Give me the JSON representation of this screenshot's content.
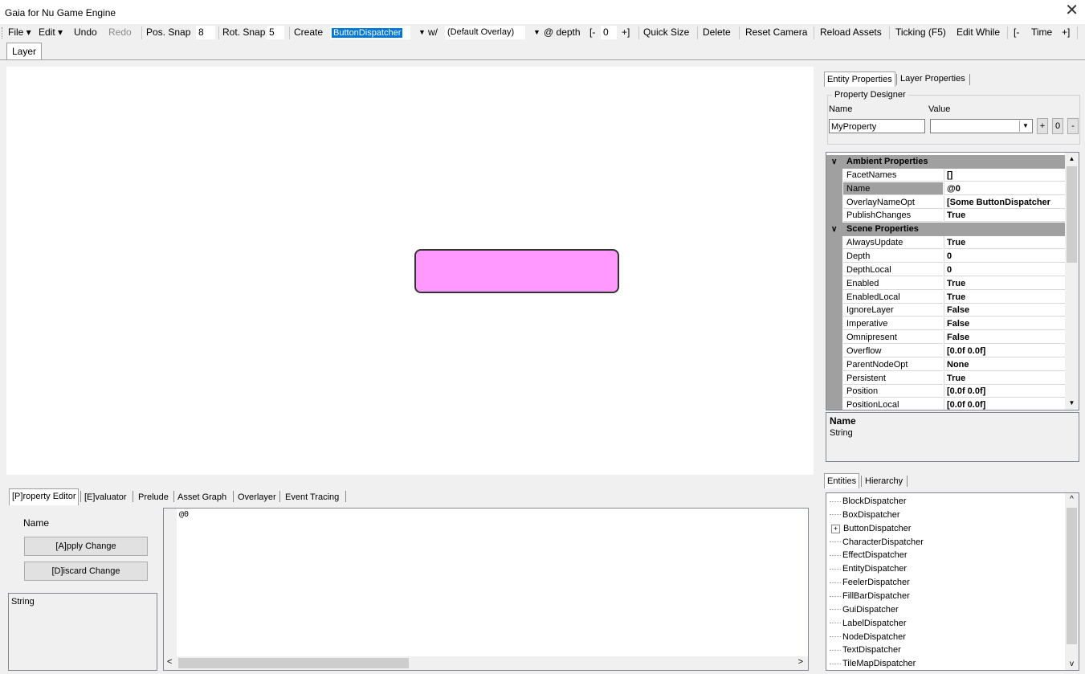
{
  "window": {
    "title": "Gaia for Nu Game Engine"
  },
  "toolbar": {
    "file": "File",
    "edit": "Edit",
    "undo": "Undo",
    "redo": "Redo",
    "pos_snap_label": "Pos. Snap",
    "pos_snap_value": "8",
    "rot_snap_label": "Rot. Snap",
    "rot_snap_value": "5",
    "create": "Create",
    "dispatcher_selected": "ButtonDispatcher",
    "with": "w/",
    "overlay_selected": "(Default Overlay)",
    "at_depth": "@ depth",
    "depth_minus": "[-",
    "depth_value": "0",
    "depth_plus": "+]",
    "quick_size": "Quick Size",
    "delete": "Delete",
    "reset_camera": "Reset Camera",
    "reload_assets": "Reload Assets",
    "ticking": "Ticking (F5)",
    "edit_while": "Edit While",
    "time_minus": "[-",
    "time_label": "Time",
    "time_plus": "+]"
  },
  "layer_tab": "Layer",
  "property_tabs": {
    "entity": "Entity Properties",
    "layer": "Layer Properties"
  },
  "property_designer": {
    "group_label": "Property Designer",
    "name_header": "Name",
    "value_header": "Value",
    "name_value": "MyProperty",
    "value_value": "",
    "plus": "+",
    "zero": "0",
    "minus": "-"
  },
  "property_grid": [
    {
      "type": "category",
      "label": "Ambient Properties"
    },
    {
      "type": "prop",
      "name": "FacetNames",
      "value": "[]"
    },
    {
      "type": "prop",
      "name": "Name",
      "value": "@0",
      "selected": true
    },
    {
      "type": "prop",
      "name": "OverlayNameOpt",
      "value": "[Some ButtonDispatcher"
    },
    {
      "type": "prop",
      "name": "PublishChanges",
      "value": "True"
    },
    {
      "type": "category",
      "label": "Scene Properties"
    },
    {
      "type": "prop",
      "name": "AlwaysUpdate",
      "value": "True"
    },
    {
      "type": "prop",
      "name": "Depth",
      "value": "0"
    },
    {
      "type": "prop",
      "name": "DepthLocal",
      "value": "0"
    },
    {
      "type": "prop",
      "name": "Enabled",
      "value": "True"
    },
    {
      "type": "prop",
      "name": "EnabledLocal",
      "value": "True"
    },
    {
      "type": "prop",
      "name": "IgnoreLayer",
      "value": "False"
    },
    {
      "type": "prop",
      "name": "Imperative",
      "value": "False"
    },
    {
      "type": "prop",
      "name": "Omnipresent",
      "value": "False"
    },
    {
      "type": "prop",
      "name": "Overflow",
      "value": "[0.0f 0.0f]"
    },
    {
      "type": "prop",
      "name": "ParentNodeOpt",
      "value": "None"
    },
    {
      "type": "prop",
      "name": "Persistent",
      "value": "True"
    },
    {
      "type": "prop",
      "name": "Position",
      "value": "[0.0f 0.0f]"
    },
    {
      "type": "prop",
      "name": "PositionLocal",
      "value": "[0.0f 0.0f]"
    }
  ],
  "help": {
    "title": "Name",
    "type": "String"
  },
  "entity_tabs": {
    "entities": "Entities",
    "hierarchy": "Hierarchy"
  },
  "entities": [
    {
      "label": "BlockDispatcher",
      "expandable": false
    },
    {
      "label": "BoxDispatcher",
      "expandable": false
    },
    {
      "label": "ButtonDispatcher",
      "expandable": true
    },
    {
      "label": "CharacterDispatcher",
      "expandable": false
    },
    {
      "label": "EffectDispatcher",
      "expandable": false
    },
    {
      "label": "EntityDispatcher",
      "expandable": false
    },
    {
      "label": "FeelerDispatcher",
      "expandable": false
    },
    {
      "label": "FillBarDispatcher",
      "expandable": false
    },
    {
      "label": "GuiDispatcher",
      "expandable": false
    },
    {
      "label": "LabelDispatcher",
      "expandable": false
    },
    {
      "label": "NodeDispatcher",
      "expandable": false
    },
    {
      "label": "TextDispatcher",
      "expandable": false
    },
    {
      "label": "TileMapDispatcher",
      "expandable": false
    }
  ],
  "bottom_tabs": {
    "property_editor": "[P]roperty Editor",
    "evaluator": "[E]valuator",
    "prelude": "Prelude",
    "asset_graph": "Asset Graph",
    "overlayer": "Overlayer",
    "event_tracing": "Event Tracing"
  },
  "editor": {
    "prop_name": "Name",
    "apply": "[A]pply Change",
    "discard": "[D]iscard Change",
    "type_label": "String",
    "code": "@0"
  },
  "colors": {
    "selection": "#0078d7",
    "entity_fill": "#ff99ff",
    "grid_gutter": "#a0a0a0"
  }
}
